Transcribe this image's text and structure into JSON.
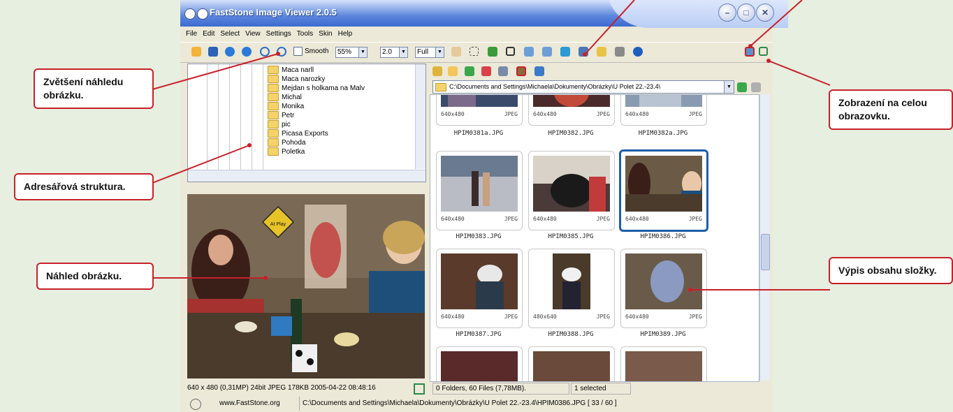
{
  "window": {
    "title": "FastStone Image Viewer 2.0.5",
    "menu": [
      "File",
      "Edit",
      "Select",
      "View",
      "Settings",
      "Tools",
      "Skin",
      "Help"
    ]
  },
  "toolbar": {
    "smooth_label": "Smooth",
    "zoom_value": "55%",
    "factor_value": "2.0",
    "mode_value": "Full"
  },
  "tree": {
    "items": [
      "Maca narll",
      "Maca narozky",
      "Mejdan s holkama na Malv",
      "Michal",
      "Monika",
      "Petr",
      "pic",
      "Picasa Exports",
      "Pohoda",
      "Poletka"
    ]
  },
  "preview": {
    "sign_text": "At Play"
  },
  "address": {
    "path": "C:\\Documents and Settings\\Michaela\\Dokumenty\\Obrázky\\U Polet 22.-23.4\\"
  },
  "thumbnails": [
    {
      "dims": "640x480",
      "type": "JPEG",
      "name": "HPIM0381a.JPG"
    },
    {
      "dims": "640x480",
      "type": "JPEG",
      "name": "HPIM0382.JPG"
    },
    {
      "dims": "640x480",
      "type": "JPEG",
      "name": "HPIM0382a.JPG"
    },
    {
      "dims": "640x480",
      "type": "JPEG",
      "name": "HPIM0383.JPG"
    },
    {
      "dims": "640x480",
      "type": "JPEG",
      "name": "HPIM0385.JPG"
    },
    {
      "dims": "640x480",
      "type": "JPEG",
      "name": "HPIM0386.JPG",
      "selected": true
    },
    {
      "dims": "640x480",
      "type": "JPEG",
      "name": "HPIM0387.JPG"
    },
    {
      "dims": "480x640",
      "type": "JPEG",
      "name": "HPIM0388.JPG"
    },
    {
      "dims": "640x480",
      "type": "JPEG",
      "name": "HPIM0389.JPG"
    }
  ],
  "status_left": "640 x 480 (0,31MP)   24bit JPEG   178KB   2005-04-22 08:48:16",
  "status_right": {
    "counts": "0 Folders, 60 Files (7,78MB).",
    "selected": "1 selected"
  },
  "bottom": {
    "website": "www.FastStone.org",
    "path": "C:\\Documents and Settings\\Michaela\\Dokumenty\\Obrázky\\U Polet 22.-23.4\\HPIM0386.JPG [ 33 / 60 ]"
  },
  "callouts": {
    "zoom": "Zvětšení náhledu obrázku.",
    "tree": "Adresářová struktura.",
    "preview": "Náhled obrázku.",
    "fullscreen": "Zobrazení na celou obrazovku.",
    "listing": "Výpis obsahu složky."
  },
  "colors": {
    "callout_border": "#c9202a",
    "selection": "#1d5fa8",
    "titlebar": "#3d6ad1"
  }
}
